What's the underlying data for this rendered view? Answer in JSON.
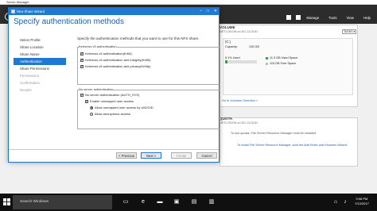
{
  "server_manager": {
    "title": "Server Manager",
    "menu": [
      "Manage",
      "Tools",
      "View",
      "Help"
    ],
    "volume": {
      "title": "VOLUME",
      "subtitle": "NETLOGON on DC-CLOUD",
      "tasks": "TASKS",
      "drive": "(C:)",
      "capacity_label": "Capacity:",
      "capacity_value": "126 GB",
      "used_percent_label": "8.1% Used",
      "used_fraction": 0.081,
      "used_space": "11.3 GB Used Space",
      "free_space": "115 GB Free Space",
      "link": "Go to Volumes Overview >"
    },
    "quota": {
      "title": "QUOTA",
      "subtitle": "NETLOGON on DC-CLOUD",
      "message": "To use quotas, File Server Resource Manager must be installed.",
      "link": "To install File Server Resource Manager, start the Add Roles and Features Wizard."
    }
  },
  "wizard": {
    "title": "New Share Wizard",
    "heading": "Specify authentication methods",
    "steps": [
      {
        "label": "Select Profile",
        "state": "normal"
      },
      {
        "label": "Share Location",
        "state": "normal"
      },
      {
        "label": "Share Name",
        "state": "normal"
      },
      {
        "label": "Authentication",
        "state": "active"
      },
      {
        "label": "Share Permissions",
        "state": "normal"
      },
      {
        "label": "Permissions",
        "state": "disabled"
      },
      {
        "label": "Confirmation",
        "state": "disabled"
      },
      {
        "label": "Results",
        "state": "disabled"
      }
    ],
    "description": "Specify the authentication methods that you want to use for this NFS share.",
    "kerberos_group": "Kerberos v5 authentication",
    "kerberos_options": [
      {
        "label": "Kerberos v5 authentication(Krb5)",
        "checked": true
      },
      {
        "label": "Kerberos v5 authentication and integrity(Krb5i)",
        "checked": true
      },
      {
        "label": "Kerberos v5 authentication and privacy(Krb5p)",
        "checked": true
      }
    ],
    "nosrv_group": "No server authentication",
    "nosrv_option": {
      "label": "No server authentication (AUTH_SYS)",
      "checked": true
    },
    "unmapped_option": {
      "label": "Enable unmapped user access",
      "checked": true
    },
    "radio_options": [
      {
        "label": "Allow unmapped user access by UID/GID",
        "checked": true
      },
      {
        "label": "Allow anonymous access",
        "checked": false
      }
    ],
    "buttons": {
      "previous": "< Previous",
      "next": "Next >",
      "create": "Create",
      "cancel": "Cancel"
    }
  },
  "taskbar": {
    "search_placeholder": "Search Windows",
    "time": "9:08 PM",
    "date": "7/13/2017"
  },
  "colors": {
    "accent": "#1f78d1",
    "used": "#2ca74a"
  }
}
